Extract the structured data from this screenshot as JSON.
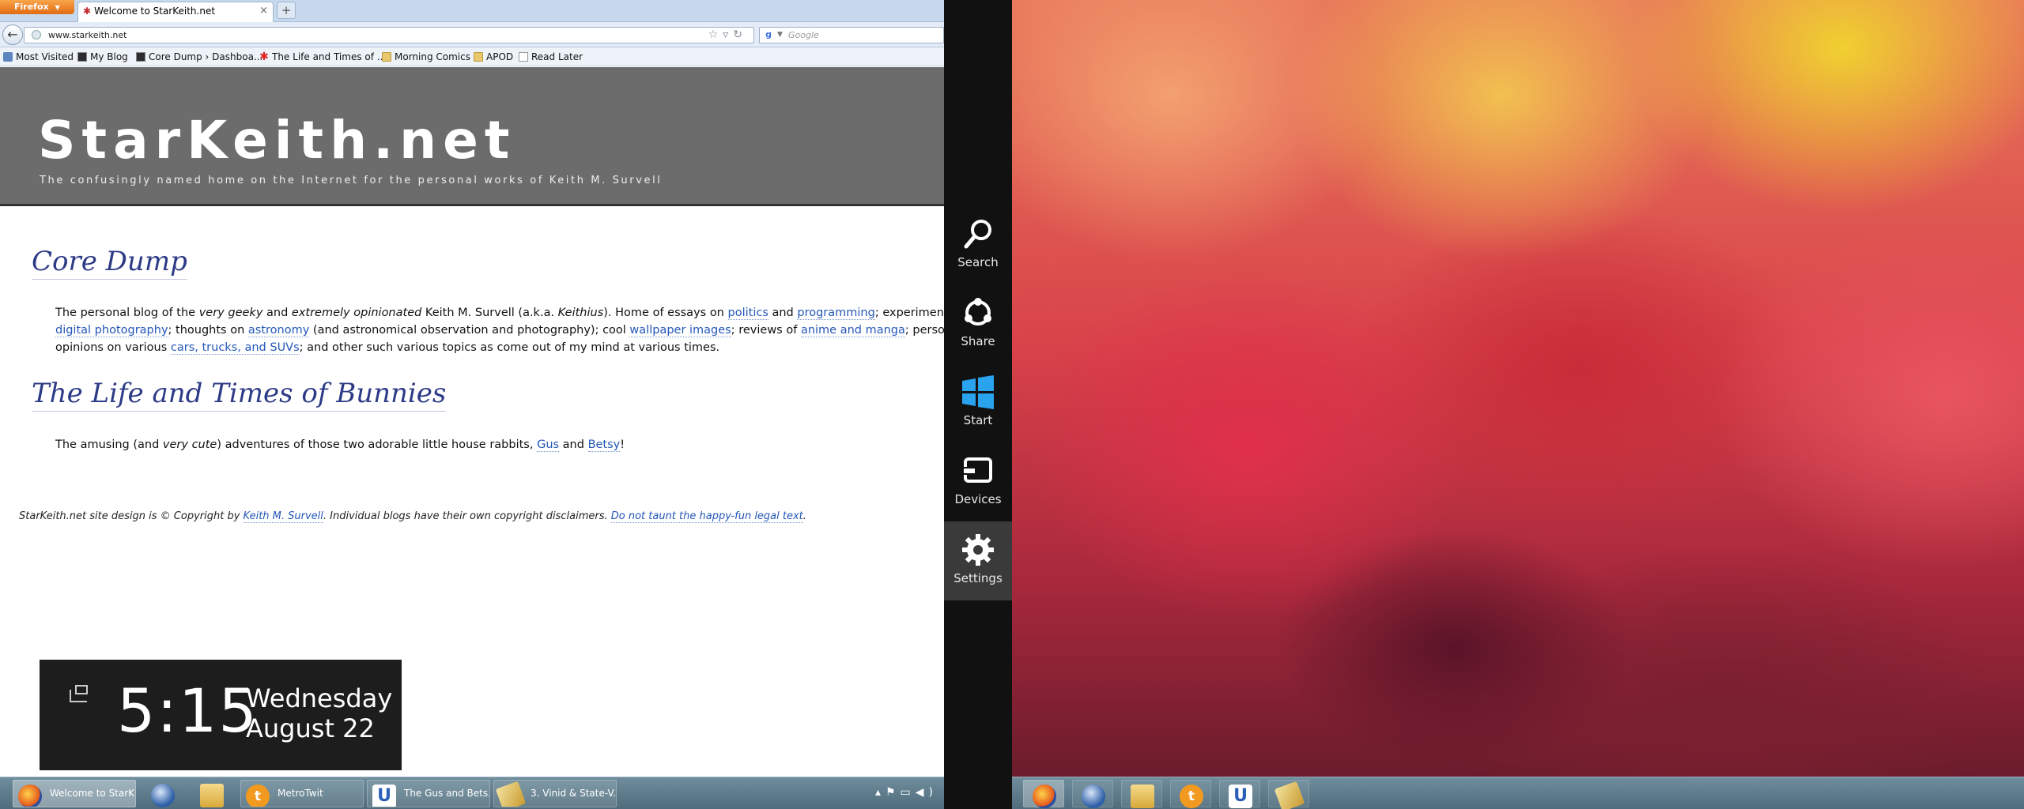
{
  "browser": {
    "app_button": "Firefox",
    "tab_title": "Welcome to StarKeith.net",
    "new_tab": "+",
    "url": "www.starkeith.net",
    "search_placeholder": "Google",
    "bookmarks": [
      {
        "label": "Most Visited",
        "icon": "blue"
      },
      {
        "label": "My Blog",
        "icon": "dark"
      },
      {
        "label": "Core Dump › Dashboa...",
        "icon": "dark"
      },
      {
        "label": "The Life and Times of ...",
        "icon": "star"
      },
      {
        "label": "Morning Comics",
        "icon": "folder"
      },
      {
        "label": "APOD",
        "icon": "folder"
      },
      {
        "label": "Read Later",
        "icon": "page"
      }
    ]
  },
  "site": {
    "title": "StarKeith.net",
    "tagline": "The confusingly named home on the Internet for the personal works of Keith M. Survell",
    "sections": [
      {
        "heading": "Core Dump"
      },
      {
        "heading": "The Life and Times of Bunnies"
      }
    ],
    "footer": {
      "text1": "StarKeith.net site design is © Copyright by ",
      "link1": "Keith M. Survell",
      "text2": ". Individual blogs have their own copyright disclaimers. ",
      "link2": "Do not taunt the happy-fun legal text",
      "text3": "."
    }
  },
  "core_dump": {
    "l1_a": "The personal blog of the ",
    "l1_em1": "very geeky",
    "l1_b": " and ",
    "l1_em2": "extremely opinionated",
    "l1_c": " Keith M. Survell (a.k.a. ",
    "l1_em3": "Keithius",
    "l1_d": "). Home of essays on ",
    "l1_link1": "politics",
    "l1_e": " and ",
    "l1_link2": "programming",
    "l1_f": "; experiment",
    "l2_link1": "digital photography",
    "l2_a": "; thoughts on ",
    "l2_link2": "astronomy",
    "l2_b": " (and astronomical observation and photography); cool ",
    "l2_link3": "wallpaper images",
    "l2_c": "; reviews of ",
    "l2_link4": "anime and manga",
    "l2_d": "; personal",
    "l3_a": "opinions on various ",
    "l3_link1": "cars, trucks, and SUVs",
    "l3_b": "; and other such various topics as come out of my mind at various times."
  },
  "bunnies": {
    "a": "The amusing (and ",
    "em": "very cute",
    "b": ") adventures of those two adorable little house rabbits, ",
    "link1": "Gus",
    "c": " and ",
    "link2": "Betsy",
    "d": "!"
  },
  "clock": {
    "time": "5:15",
    "day": "Wednesday",
    "date": "August 22"
  },
  "charms": [
    {
      "label": "Search",
      "icon": "search-icon"
    },
    {
      "label": "Share",
      "icon": "share-icon"
    },
    {
      "label": "Start",
      "icon": "windows-logo-icon"
    },
    {
      "label": "Devices",
      "icon": "devices-icon"
    },
    {
      "label": "Settings",
      "icon": "gear-icon"
    }
  ],
  "taskbar_left": {
    "buttons": [
      {
        "label": "Welcome to StarK...",
        "icon": "firefox-icon",
        "active": true
      },
      {
        "label": "MetroTwit",
        "icon": "metrotwit-icon"
      },
      {
        "label": "The Gus and Bets...",
        "icon": "u-app-icon"
      },
      {
        "label": "3. Vinid & State-V...",
        "icon": "pencil-app-icon"
      }
    ],
    "icon_only": [
      "thunderbird-icon",
      "explorer-folder-icon"
    ]
  },
  "taskbar_right": {
    "icons": [
      "firefox-icon",
      "thunderbird-icon",
      "explorer-folder-icon",
      "metrotwit-icon",
      "u-app-icon",
      "pencil-app-icon"
    ]
  },
  "colors": {
    "link": "#2457b8",
    "heading": "#2d3a86",
    "header_bg": "#6c6c6c",
    "charms_bg": "#111111"
  }
}
